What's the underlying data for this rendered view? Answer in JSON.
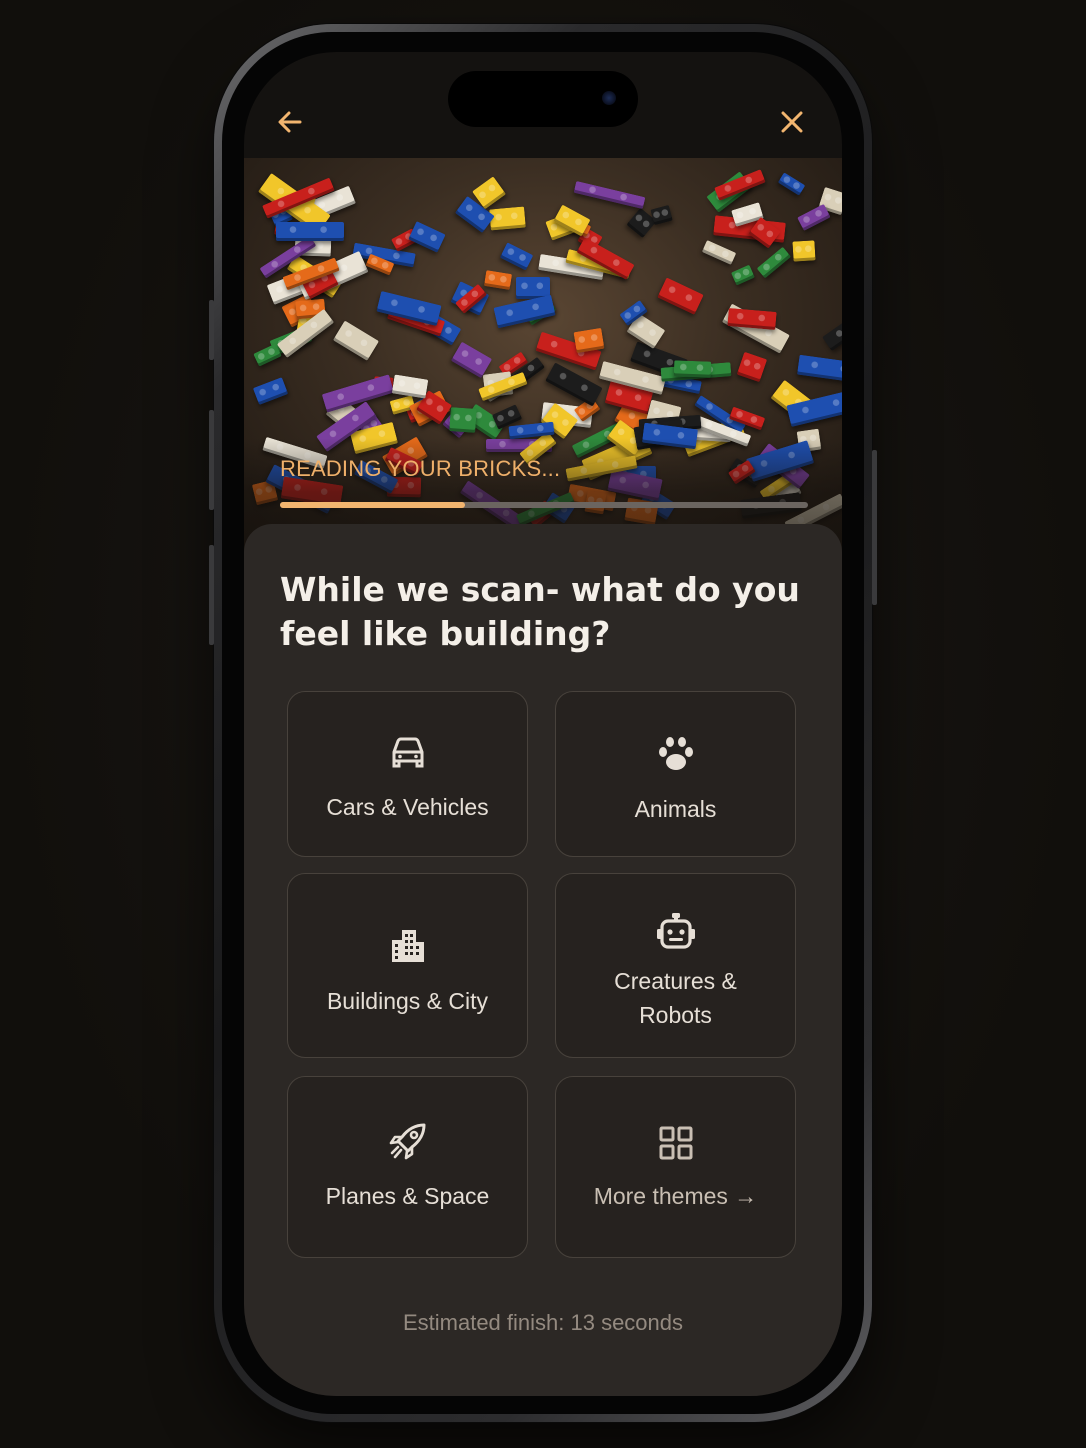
{
  "topbar": {
    "back_icon": "arrow-left-icon",
    "close_icon": "close-icon",
    "accent": "#f2b56f"
  },
  "hero": {
    "image": "pile of colorful toy bricks",
    "status": "READING YOUR BRICKS...",
    "progress": 0.35
  },
  "sheet": {
    "title": "While we scan- what do you feel like building?",
    "themes": [
      {
        "label": "Cars & Vehicles",
        "icon": "car-icon"
      },
      {
        "label": "Animals",
        "icon": "paw-icon"
      },
      {
        "label": "Buildings & City",
        "icon": "buildings-icon"
      },
      {
        "label": "Creatures & Robots",
        "icon": "robot-icon"
      },
      {
        "label": "Planes & Space",
        "icon": "rocket-icon"
      },
      {
        "label": "More themes →",
        "icon": "grid-icon"
      }
    ],
    "estimate": "Estimated finish: 13 seconds"
  }
}
